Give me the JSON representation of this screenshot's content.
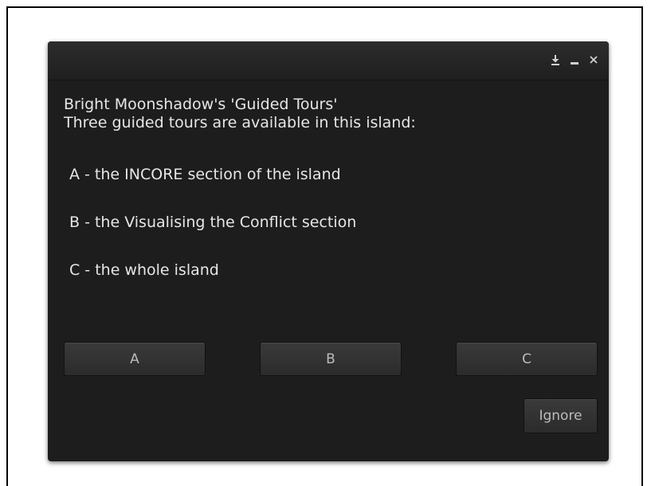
{
  "dialog": {
    "title_lines": [
      "Bright Moonshadow's 'Guided Tours'",
      "Three guided tours are available in this island:"
    ],
    "options": [
      "A - the INCORE section of the island",
      "B - the Visualising the Conflict section",
      "C - the whole island"
    ],
    "buttons": {
      "a": "A",
      "b": "B",
      "c": "C",
      "ignore": "Ignore"
    },
    "titlebar_icons": [
      "download-icon",
      "minimize-icon",
      "close-icon"
    ]
  },
  "colors": {
    "dialog_bg": "#1d1d1d",
    "text": "#e6e6e6",
    "button_text": "#bcbcbc",
    "page_bg": "#ffffff"
  }
}
